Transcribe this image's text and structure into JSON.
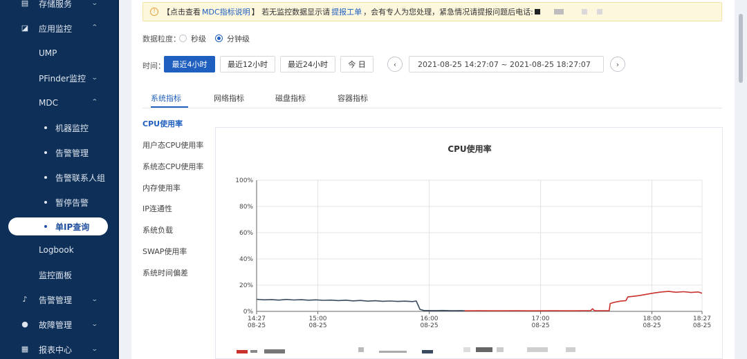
{
  "sidebar": {
    "items": [
      {
        "label": "存储服务",
        "icon": "storage-icon",
        "chevron": "down"
      },
      {
        "label": "应用监控",
        "icon": "monitor-icon",
        "chevron": "up"
      },
      {
        "label": "UMP"
      },
      {
        "label": "PFinder监控",
        "chevron": "down"
      },
      {
        "label": "MDC",
        "chevron": "up"
      },
      {
        "label": "机器监控"
      },
      {
        "label": "告警管理"
      },
      {
        "label": "告警联系人组"
      },
      {
        "label": "暂停告警"
      },
      {
        "label": "单IP查询",
        "active": true
      },
      {
        "label": "Logbook"
      },
      {
        "label": "监控面板"
      },
      {
        "label": "告警管理",
        "icon": "bell-icon",
        "chevron": "down"
      },
      {
        "label": "故障管理",
        "icon": "fault-icon",
        "chevron": "down"
      },
      {
        "label": "报表中心",
        "icon": "report-icon",
        "chevron": "down"
      }
    ]
  },
  "notice": {
    "prefix": "【点击查看",
    "link1": "MDC指标说明",
    "middle": "】 若无监控数据显示请",
    "link2": "提报工单",
    "suffix": "，会有专人为您处理，紧急情况请提报问题后电话:"
  },
  "granularity": {
    "label": "数据粒度：",
    "options": [
      "秒级",
      "分钟级"
    ],
    "selected": "分钟级"
  },
  "time": {
    "label": "时间：",
    "quick": [
      "最近4小时",
      "最近12小时",
      "最近24小时",
      "今 日"
    ],
    "selected": "最近4小时",
    "range": "2021-08-25 14:27:07 ~ 2021-08-25 18:27:07",
    "prev_icon": "chevron-left-icon",
    "next_icon": "chevron-right-icon"
  },
  "tabs": [
    "系统指标",
    "网络指标",
    "磁盘指标",
    "容器指标"
  ],
  "active_tab": "系统指标",
  "metrics": [
    "CPU使用率",
    "用户态CPU使用率",
    "系统态CPU使用率",
    "内存使用率",
    "IP连通性",
    "系统负载",
    "SWAP使用率",
    "系统时间偏差"
  ],
  "active_metric": "CPU使用率",
  "chart_data": {
    "type": "line",
    "title": "CPU使用率",
    "xlabel": "",
    "ylabel": "",
    "ylim": [
      0,
      100
    ],
    "y_ticks": [
      "0%",
      "20%",
      "40%",
      "60%",
      "80%",
      "100%"
    ],
    "x_ticks": [
      {
        "time": "14:27",
        "date": "08-25",
        "minutes": 0
      },
      {
        "time": "15:00",
        "date": "08-25",
        "minutes": 33
      },
      {
        "time": "16:00",
        "date": "08-25",
        "minutes": 93
      },
      {
        "time": "17:00",
        "date": "08-25",
        "minutes": 153
      },
      {
        "time": "18:00",
        "date": "08-25",
        "minutes": 213
      },
      {
        "time": "18:27",
        "date": "08-25",
        "minutes": 240
      }
    ],
    "grid": true,
    "colors": {
      "series1": "#3a4a5e",
      "series2": "#c9302c"
    },
    "series": [
      {
        "values": [
          [
            0,
            9.2
          ],
          [
            4,
            8.8
          ],
          [
            8,
            9.0
          ],
          [
            12,
            8.6
          ],
          [
            16,
            9.1
          ],
          [
            20,
            8.7
          ],
          [
            24,
            8.9
          ],
          [
            28,
            8.5
          ],
          [
            32,
            8.8
          ],
          [
            36,
            8.4
          ],
          [
            40,
            8.6
          ],
          [
            44,
            8.2
          ],
          [
            48,
            8.5
          ],
          [
            52,
            8.0
          ],
          [
            56,
            8.3
          ],
          [
            60,
            7.8
          ],
          [
            64,
            8.1
          ],
          [
            68,
            7.7
          ],
          [
            72,
            7.9
          ],
          [
            76,
            7.6
          ],
          [
            80,
            7.8
          ],
          [
            84,
            7.5
          ],
          [
            86,
            7.9
          ],
          [
            88,
            1.5
          ],
          [
            90,
            0.7
          ],
          [
            95,
            0.6
          ],
          [
            100,
            0.7
          ],
          [
            105,
            0.5
          ],
          [
            110,
            0.6
          ],
          [
            112,
            0.5
          ]
        ]
      },
      {
        "values": [
          [
            112,
            0.4
          ],
          [
            120,
            0.5
          ],
          [
            130,
            0.4
          ],
          [
            140,
            0.5
          ],
          [
            150,
            0.4
          ],
          [
            160,
            0.5
          ],
          [
            170,
            0.4
          ],
          [
            180,
            0.6
          ],
          [
            181,
            2.0
          ],
          [
            182,
            0.5
          ],
          [
            190,
            0.6
          ],
          [
            190.5,
            6.0
          ],
          [
            193,
            7.0
          ],
          [
            196,
            7.8
          ],
          [
            199,
            8.2
          ],
          [
            200,
            11.0
          ],
          [
            203,
            11.5
          ],
          [
            206,
            12.0
          ],
          [
            210,
            13.0
          ],
          [
            214,
            14.0
          ],
          [
            218,
            14.8
          ],
          [
            222,
            15.2
          ],
          [
            226,
            14.6
          ],
          [
            230,
            15.0
          ],
          [
            234,
            14.4
          ],
          [
            238,
            14.8
          ],
          [
            240,
            13.8
          ]
        ]
      }
    ]
  }
}
